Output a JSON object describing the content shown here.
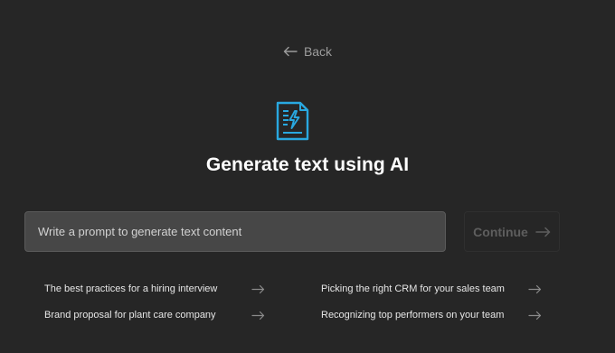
{
  "back": {
    "label": "Back",
    "icon": "arrow-left-icon"
  },
  "header": {
    "icon": "ai-document-icon",
    "title": "Generate text using AI"
  },
  "prompt": {
    "placeholder": "Write a prompt to generate text content",
    "value": ""
  },
  "continue": {
    "label": "Continue",
    "icon": "arrow-right-icon",
    "enabled": false
  },
  "suggestions": [
    {
      "label": "The best practices for a hiring interview",
      "icon": "arrow-right-icon"
    },
    {
      "label": "Picking the right CRM for your sales team",
      "icon": "arrow-right-icon"
    },
    {
      "label": "Brand proposal for plant care company",
      "icon": "arrow-right-icon"
    },
    {
      "label": "Recognizing top performers on your team",
      "icon": "arrow-right-icon"
    }
  ],
  "colors": {
    "background": "#262626",
    "accent": "#29a8e0",
    "input_bg": "#474747",
    "muted_text": "#9c9c9c",
    "disabled_text": "#5e5e5e"
  }
}
